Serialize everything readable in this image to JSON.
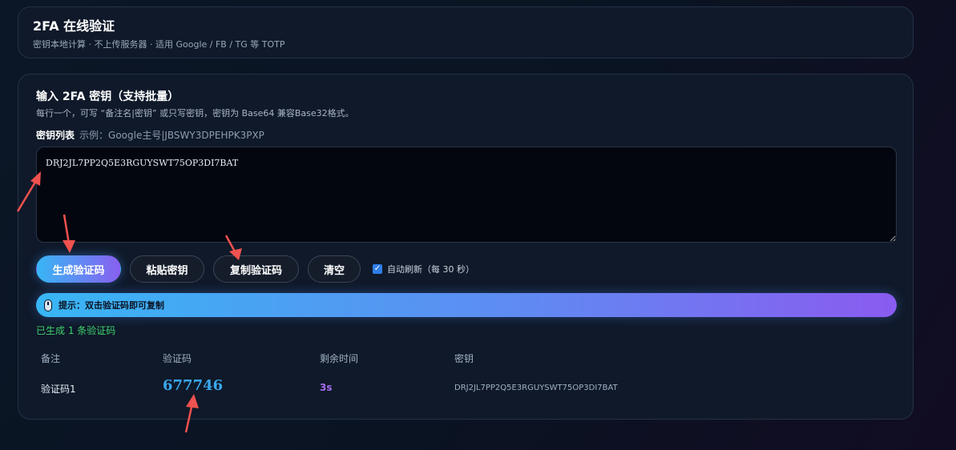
{
  "header": {
    "title": "2FA 在线验证",
    "subtitle": "密钥本地计算 · 不上传服务器 · 适用 Google / FB / TG 等 TOTP"
  },
  "input_section": {
    "title": "输入 2FA 密钥（支持批量）",
    "description": "每行一个，可写 “备注名|密钥” 或只写密钥，密钥为 Base64 兼容Base32格式。",
    "list_label": "密钥列表",
    "list_example": "示例：Google主号|JBSWY3DPEHPK3PXP",
    "textarea_value": "DRJ2JL7PP2Q5E3RGUYSWT75OP3DI7BAT"
  },
  "buttons": {
    "generate": "生成验证码",
    "paste": "粘贴密钥",
    "copy": "复制验证码",
    "clear": "清空"
  },
  "auto_refresh": {
    "checked": true,
    "label": "自动刷新（每 30 秒）"
  },
  "hint": {
    "icon": "mouse-icon",
    "text": "提示：双击验证码即可复制"
  },
  "status": {
    "generated_text": "已生成 1 条验证码"
  },
  "table": {
    "headers": [
      "备注",
      "验证码",
      "剩余时间",
      "密钥"
    ],
    "rows": [
      {
        "name": "验证码1",
        "code": "677746",
        "remaining": "3s",
        "key": "DRJ2JL7PP2Q5E3RGUYSWT75OP3DI7BAT"
      }
    ]
  },
  "colors": {
    "accent_start": "#38b5f5",
    "accent_end": "#8860f0",
    "success": "#3fd16e",
    "code": "#3aa8f0",
    "remaining": "#a76df0",
    "annotation_arrow": "#f0524f"
  }
}
